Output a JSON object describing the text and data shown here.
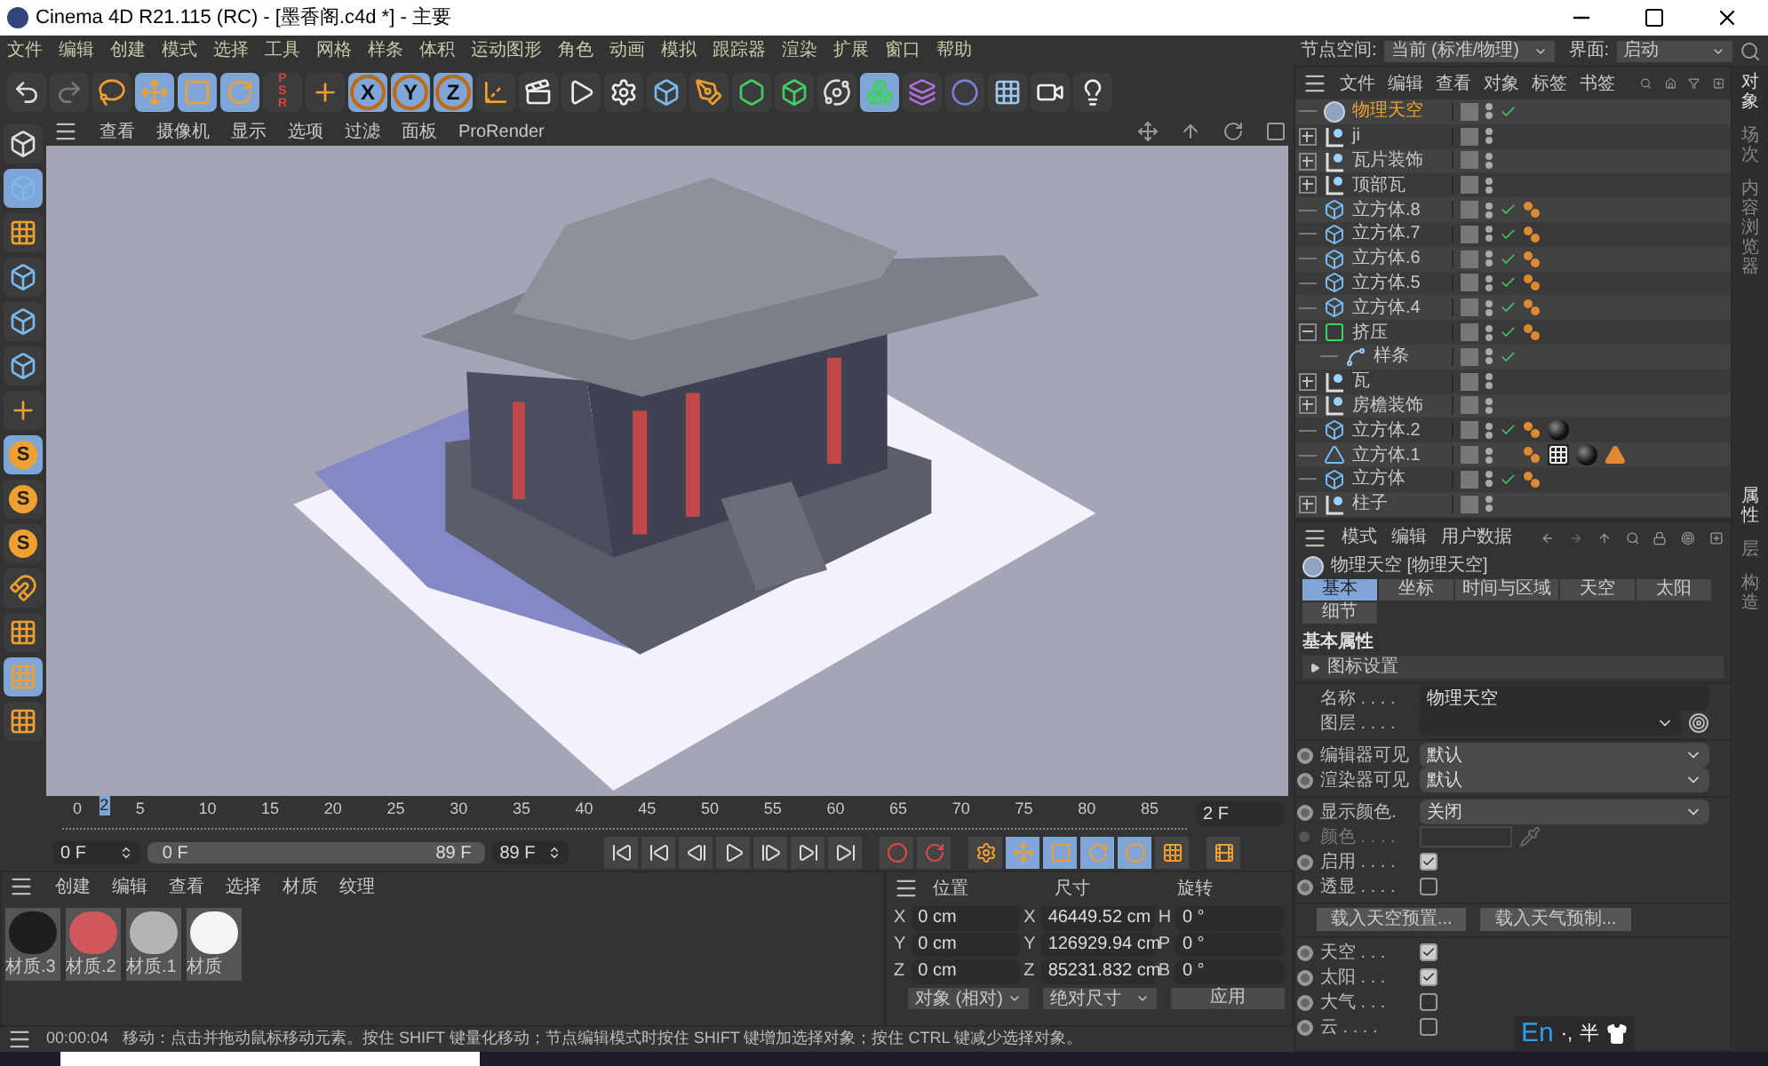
{
  "window": {
    "title": "Cinema 4D R21.115 (RC) - [墨香阁.c4d *] - 主要"
  },
  "menu": [
    "文件",
    "编辑",
    "创建",
    "模式",
    "选择",
    "工具",
    "网格",
    "样条",
    "体积",
    "运动图形",
    "角色",
    "动画",
    "模拟",
    "跟踪器",
    "渲染",
    "扩展",
    "窗口",
    "帮助"
  ],
  "node_space": {
    "label": "节点空间:",
    "value": "当前 (标准/物理)",
    "layout_label": "界面:",
    "layout_value": "启动"
  },
  "toolbar": [
    {
      "kind": "undo",
      "selected": false
    },
    {
      "kind": "redo",
      "selected": false
    },
    {
      "kind": "lasso",
      "selected": false
    },
    {
      "kind": "move",
      "selected": true
    },
    {
      "kind": "scale",
      "selected": true
    },
    {
      "kind": "rotate",
      "selected": true
    },
    {
      "kind": "psr",
      "label": "PSR",
      "selected": false
    },
    {
      "kind": "axis",
      "selected": false
    },
    {
      "kind": "letter",
      "label": "X",
      "selected": true
    },
    {
      "kind": "letter",
      "label": "Y",
      "selected": true
    },
    {
      "kind": "letter",
      "label": "Z",
      "selected": true
    },
    {
      "kind": "coord",
      "selected": false
    },
    {
      "kind": "render-view",
      "selected": false
    },
    {
      "kind": "render",
      "selected": false
    },
    {
      "kind": "render-settings",
      "selected": false
    },
    {
      "kind": "cube",
      "selected": false
    },
    {
      "kind": "pen",
      "selected": false
    },
    {
      "kind": "subdiv",
      "selected": false
    },
    {
      "kind": "extrude",
      "selected": false
    },
    {
      "kind": "cloner",
      "selected": false
    },
    {
      "kind": "mograph",
      "selected": true
    },
    {
      "kind": "deformer",
      "selected": false
    },
    {
      "kind": "field",
      "selected": false
    },
    {
      "kind": "floor",
      "selected": false
    },
    {
      "kind": "camera",
      "selected": false
    },
    {
      "kind": "light",
      "selected": false
    }
  ],
  "left_tools": [
    {
      "kind": "model",
      "selected": false
    },
    {
      "kind": "cube",
      "selected": true
    },
    {
      "kind": "checker",
      "selected": false
    },
    {
      "kind": "cube",
      "selected": false
    },
    {
      "kind": "cube",
      "selected": false
    },
    {
      "kind": "cube",
      "selected": false
    },
    {
      "kind": "axis",
      "selected": false
    },
    {
      "kind": "snap",
      "label": "S",
      "selected": true
    },
    {
      "kind": "snap",
      "label": "S",
      "selected": false
    },
    {
      "kind": "snap",
      "label": "S",
      "selected": false
    },
    {
      "kind": "magnet",
      "selected": false
    },
    {
      "kind": "grid",
      "selected": false
    },
    {
      "kind": "grid",
      "selected": true
    },
    {
      "kind": "grid",
      "selected": false
    }
  ],
  "viewport": {
    "menu": [
      "查看",
      "摄像机",
      "显示",
      "选项",
      "过滤",
      "面板",
      "ProRender"
    ]
  },
  "timeline": {
    "ticks": [
      "0",
      "5",
      "10",
      "15",
      "20",
      "25",
      "30",
      "35",
      "40",
      "45",
      "50",
      "55",
      "60",
      "65",
      "70",
      "75",
      "80",
      "85"
    ],
    "playhead": {
      "label": "2",
      "level": 0.0225
    },
    "start": "0 F",
    "range_start": "0 F",
    "range_end": "89 F",
    "end": "89 F",
    "current": "2 F"
  },
  "materials": {
    "menu": [
      "创建",
      "编辑",
      "查看",
      "选择",
      "材质",
      "纹理"
    ],
    "items": [
      {
        "name": "材质.3",
        "color": "#1e1e1e"
      },
      {
        "name": "材质.2",
        "color": "#d0585c"
      },
      {
        "name": "材质.1",
        "color": "#b4b4b4"
      },
      {
        "name": "材质",
        "color": "#f4f4f4"
      }
    ]
  },
  "coordinates": {
    "headers": [
      "位置",
      "尺寸",
      "旋转"
    ],
    "rows": [
      {
        "cells": [
          {
            "axis": "X",
            "value": "0 cm"
          },
          {
            "axis": "X",
            "value": "46449.52 cm"
          },
          {
            "axis": "H",
            "value": "0 °"
          }
        ]
      },
      {
        "cells": [
          {
            "axis": "Y",
            "value": "0 cm"
          },
          {
            "axis": "Y",
            "value": "126929.94 cm"
          },
          {
            "axis": "P",
            "value": "0 °"
          }
        ]
      },
      {
        "cells": [
          {
            "axis": "Z",
            "value": "0 cm"
          },
          {
            "axis": "Z",
            "value": "85231.832 cm"
          },
          {
            "axis": "B",
            "value": "0 °"
          }
        ]
      }
    ],
    "mode": "对象 (相对)",
    "size_mode": "绝对尺寸",
    "apply": "应用"
  },
  "status_bar": {
    "time": "00:00:04",
    "message": "移动：点击并拖动鼠标移动元素。按住 SHIFT 键量化移动；节点编辑模式时按住 SHIFT 键增加选择对象；按住 CTRL 键减少选择对象。"
  },
  "objects": {
    "menu": [
      "文件",
      "编辑",
      "查看",
      "对象",
      "标签",
      "书签"
    ],
    "items": [
      {
        "name": "物理天空",
        "kind": "sky",
        "selected": true,
        "enabled": true
      },
      {
        "name": "ji",
        "kind": "null",
        "expanded": false,
        "selected": false,
        "enabled": false
      },
      {
        "name": "瓦片装饰",
        "kind": "null",
        "expanded": false,
        "selected": false,
        "enabled": false
      },
      {
        "name": "顶部瓦",
        "kind": "null",
        "expanded": false,
        "selected": false,
        "enabled": false
      },
      {
        "name": "立方体.8",
        "kind": "cube",
        "selected": false,
        "enabled": true,
        "tags": [
          {
            "kind": "phong"
          }
        ]
      },
      {
        "name": "立方体.7",
        "kind": "cube",
        "selected": false,
        "enabled": true,
        "tags": [
          {
            "kind": "phong"
          }
        ]
      },
      {
        "name": "立方体.6",
        "kind": "cube",
        "selected": false,
        "enabled": true,
        "tags": [
          {
            "kind": "phong"
          }
        ]
      },
      {
        "name": "立方体.5",
        "kind": "cube",
        "selected": false,
        "enabled": true,
        "tags": [
          {
            "kind": "phong"
          }
        ]
      },
      {
        "name": "立方体.4",
        "kind": "cube",
        "selected": false,
        "enabled": true,
        "tags": [
          {
            "kind": "phong"
          }
        ]
      },
      {
        "name": "挤压",
        "kind": "extrude",
        "expanded": true,
        "selected": false,
        "enabled": true,
        "tags": [
          {
            "kind": "phong"
          }
        ],
        "children": [
          {
            "name": "样条",
            "kind": "spline",
            "selected": false,
            "enabled": true
          }
        ]
      },
      {
        "name": "瓦",
        "kind": "null",
        "expanded": false,
        "selected": false,
        "enabled": false
      },
      {
        "name": "房檐装饰",
        "kind": "null",
        "expanded": false,
        "selected": false,
        "enabled": false
      },
      {
        "name": "立方体.2",
        "kind": "cube",
        "selected": false,
        "enabled": true,
        "tags": [
          {
            "kind": "phong"
          },
          {
            "kind": "material"
          }
        ]
      },
      {
        "name": "立方体.1",
        "kind": "figure",
        "selected": false,
        "enabled": false,
        "tags": [
          {
            "kind": "phong"
          },
          {
            "kind": "checker"
          },
          {
            "kind": "material"
          },
          {
            "kind": "cone"
          }
        ]
      },
      {
        "name": "立方体",
        "kind": "cube",
        "selected": false,
        "enabled": true,
        "tags": [
          {
            "kind": "phong"
          }
        ]
      },
      {
        "name": "柱子",
        "kind": "null",
        "expanded": false,
        "selected": false,
        "enabled": false
      }
    ]
  },
  "side_tabs_top": [
    {
      "label": "对象",
      "selected": true
    },
    {
      "label": "场次",
      "selected": false
    },
    {
      "label": "内容浏览器",
      "selected": false
    }
  ],
  "side_tabs_bottom": [
    {
      "label": "属性",
      "selected": true
    },
    {
      "label": "层",
      "selected": false
    },
    {
      "label": "构造",
      "selected": false
    }
  ],
  "attributes": {
    "menu": [
      "模式",
      "编辑",
      "用户数据"
    ],
    "title": "物理天空 [物理天空]",
    "tabs": [
      {
        "label": "基本",
        "selected": true
      },
      {
        "label": "坐标",
        "selected": false
      },
      {
        "label": "时间与区域",
        "selected": false
      },
      {
        "label": "天空",
        "selected": false
      },
      {
        "label": "太阳",
        "selected": false
      },
      {
        "label": "细节",
        "selected": false
      }
    ],
    "section": "基本属性",
    "group": "图标设置",
    "sections": [
      {
        "kind": "rows",
        "rows": [
          {
            "kind": "text",
            "label": "名称 . . . .",
            "value": "物理天空",
            "anim": false
          },
          {
            "kind": "layer",
            "label": "图层 . . . .",
            "anim": false
          }
        ]
      },
      {
        "kind": "rows",
        "rows": [
          {
            "kind": "select",
            "label": "编辑器可见",
            "value": "默认",
            "anim": true
          },
          {
            "kind": "select",
            "label": "渲染器可见",
            "value": "默认",
            "anim": true
          }
        ]
      },
      {
        "kind": "rows",
        "rows": [
          {
            "kind": "select",
            "label": "显示颜色.",
            "value": "关闭",
            "anim": true
          },
          {
            "kind": "color",
            "label": "颜色 . . . .",
            "anim": true,
            "disabled": true
          },
          {
            "kind": "check",
            "label": "启用 . . . .",
            "checked": true,
            "anim": true
          },
          {
            "kind": "check",
            "label": "透显 . . . .",
            "checked": false,
            "anim": true
          }
        ]
      },
      {
        "kind": "buttons",
        "buttons": [
          "载入天空预置...",
          "载入天气预制..."
        ]
      },
      {
        "kind": "rows",
        "rows": [
          {
            "kind": "check",
            "label": "天空 . . .",
            "checked": true,
            "anim": true
          },
          {
            "kind": "check",
            "label": "太阳 . . .",
            "checked": true,
            "anim": true
          },
          {
            "kind": "check",
            "label": "大气 . . .",
            "checked": false,
            "anim": true
          },
          {
            "kind": "check",
            "label": "云 . . . .",
            "checked": false,
            "anim": true
          }
        ]
      }
    ]
  },
  "ime": {
    "lang": "En",
    "punct": "·,",
    "width": "半"
  }
}
